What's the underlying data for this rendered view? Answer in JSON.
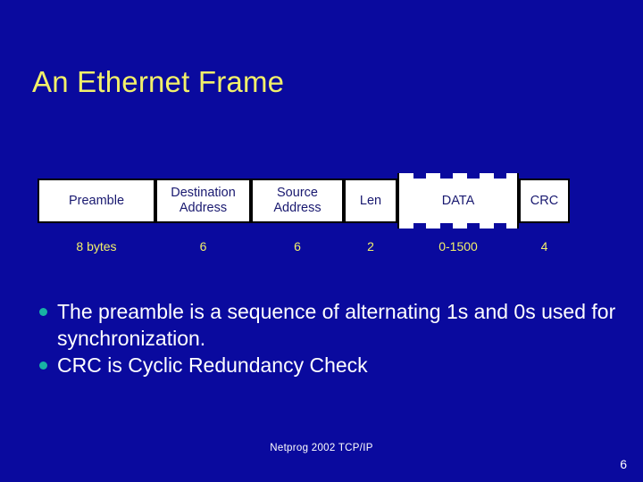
{
  "slide": {
    "title": "An Ethernet Frame",
    "background_color": "#0A0A9E",
    "title_color": "#F2F06A",
    "body_text_color": "#FFFFFF",
    "bullet_marker_color": "#18B2A4",
    "cell_fill_color": "#FFFFFF",
    "cell_text_color": "#191970",
    "cell_border_color": "#000000",
    "size_label_color": "#F2F06A"
  },
  "frame": {
    "fields": [
      {
        "name": "Preamble",
        "label": "Preamble",
        "size": "8 bytes",
        "variable_length": false
      },
      {
        "name": "Destination Address",
        "label": "Destination Address",
        "size": "6",
        "variable_length": false
      },
      {
        "name": "Source Address",
        "label": "Source Address",
        "size": "6",
        "variable_length": false
      },
      {
        "name": "Len",
        "label": "Len",
        "size": "2",
        "variable_length": false
      },
      {
        "name": "DATA",
        "label": "DATA",
        "size": "0-1500",
        "variable_length": true
      },
      {
        "name": "CRC",
        "label": "CRC",
        "size": "4",
        "variable_length": false
      }
    ]
  },
  "bullets": [
    {
      "text": "The preamble is a sequence of alternating 1s and 0s used for synchronization."
    },
    {
      "text": "CRC is Cyclic Redundancy Check"
    }
  ],
  "footer": {
    "note": "Netprog 2002  TCP/IP",
    "page_number": "6"
  }
}
